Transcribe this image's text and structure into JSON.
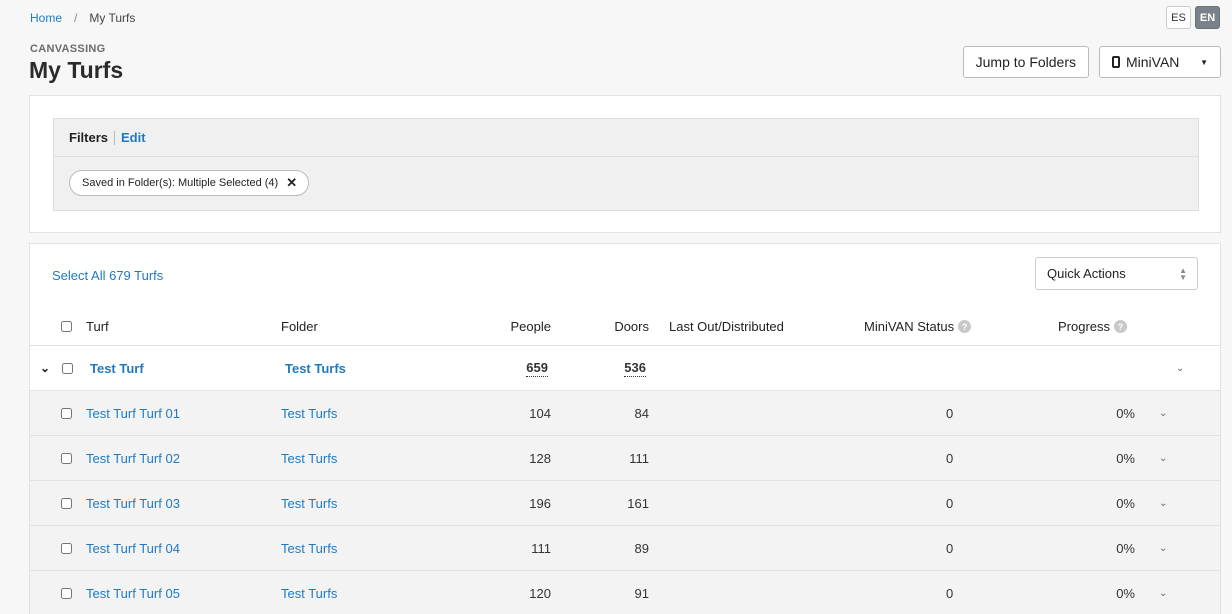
{
  "breadcrumb": {
    "home": "Home",
    "separator": "/",
    "current": "My Turfs"
  },
  "language": {
    "es": "ES",
    "en": "EN",
    "active": "EN"
  },
  "header": {
    "eyebrow": "CANVASSING",
    "title": "My Turfs"
  },
  "actions": {
    "jump_to_folders": "Jump to Folders",
    "minivan": "MiniVAN"
  },
  "filters": {
    "title": "Filters",
    "edit": "Edit",
    "chip": {
      "key": "Saved in Folder(s):",
      "value": "Multiple Selected (4)"
    }
  },
  "table": {
    "select_all": "Select All 679 Turfs",
    "quick_actions": "Quick Actions",
    "columns": {
      "turf": "Turf",
      "folder": "Folder",
      "people": "People",
      "doors": "Doors",
      "last_out": "Last Out/Distributed",
      "minivan_status": "MiniVAN Status",
      "progress": "Progress"
    },
    "parent": {
      "turf": "Test Turf",
      "folder": "Test Turfs",
      "people": "659",
      "doors": "536"
    },
    "rows": [
      {
        "turf": "Test Turf Turf 01",
        "folder": "Test Turfs",
        "people": "104",
        "doors": "84",
        "minivan_status": "0",
        "progress": "0%"
      },
      {
        "turf": "Test Turf Turf 02",
        "folder": "Test Turfs",
        "people": "128",
        "doors": "111",
        "minivan_status": "0",
        "progress": "0%"
      },
      {
        "turf": "Test Turf Turf 03",
        "folder": "Test Turfs",
        "people": "196",
        "doors": "161",
        "minivan_status": "0",
        "progress": "0%"
      },
      {
        "turf": "Test Turf Turf 04",
        "folder": "Test Turfs",
        "people": "111",
        "doors": "89",
        "minivan_status": "0",
        "progress": "0%"
      },
      {
        "turf": "Test Turf Turf 05",
        "folder": "Test Turfs",
        "people": "120",
        "doors": "91",
        "minivan_status": "0",
        "progress": "0%"
      }
    ]
  }
}
